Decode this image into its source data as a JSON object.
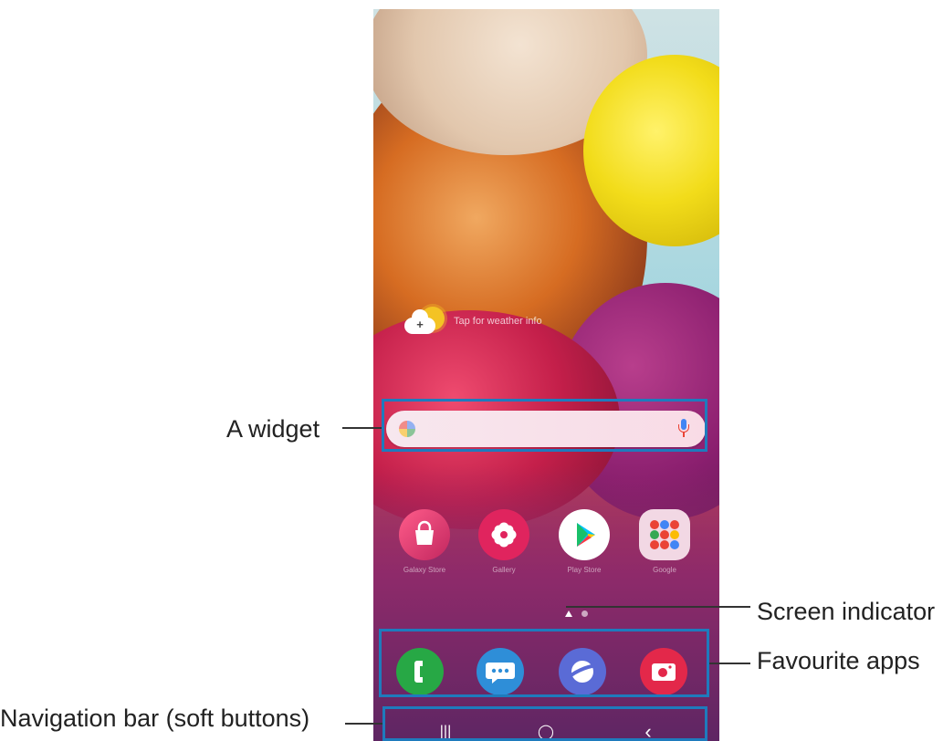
{
  "callouts": {
    "widget": "A widget",
    "screen_indicator": "Screen indicator",
    "favourite_apps": "Favourite apps",
    "navigation_bar": "Navigation bar (soft buttons)"
  },
  "weather": {
    "icon": "weather-sun-cloud-plus-icon",
    "text": "Tap for weather info"
  },
  "search": {
    "left_icon": "google-g-icon",
    "right_icon": "microphone-icon"
  },
  "apps": [
    {
      "id": "store",
      "label": "Galaxy Store",
      "icon": "shopping-bag-icon"
    },
    {
      "id": "gallery",
      "label": "Gallery",
      "icon": "flower-icon"
    },
    {
      "id": "play",
      "label": "Play Store",
      "icon": "play-store-triangle-icon"
    },
    {
      "id": "google",
      "label": "Google",
      "icon": "google-folder-icon"
    }
  ],
  "dock": [
    {
      "id": "phone",
      "icon": "phone-handset-icon"
    },
    {
      "id": "messages",
      "icon": "chat-bubble-icon"
    },
    {
      "id": "internet",
      "icon": "planet-icon"
    },
    {
      "id": "camera",
      "icon": "camera-icon"
    }
  ],
  "navbar": {
    "recent": "|||",
    "home": "◯",
    "back": "‹"
  },
  "colors": {
    "callout_box": "#1e7bbd",
    "leader_line": "#333333"
  }
}
